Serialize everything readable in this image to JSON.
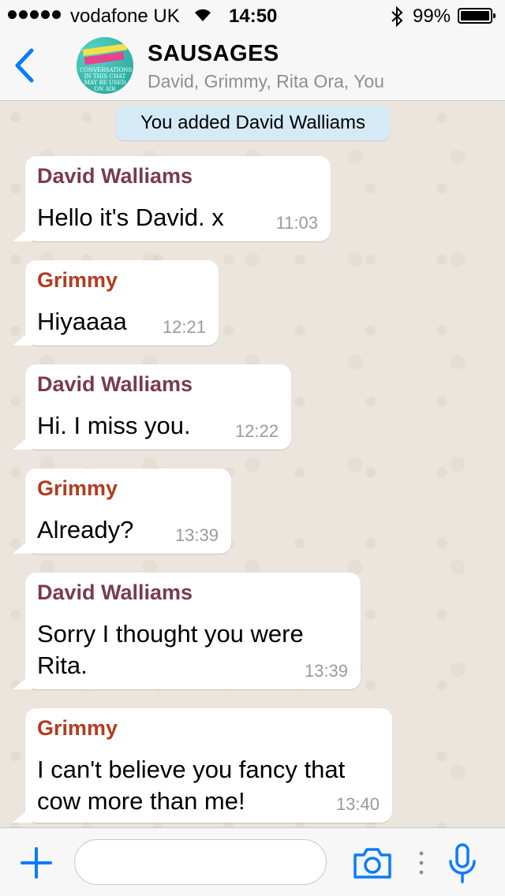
{
  "status_bar": {
    "carrier": "vodafone UK",
    "time": "14:50",
    "battery": "99%"
  },
  "header": {
    "title": "SAUSAGES",
    "subtitle": "David, Grimmy, Rita Ora, You",
    "avatar_caption": "CONVERSATIONS IN THIS CHAT MAY BE USED ON AIR"
  },
  "chat": {
    "system_message": "You added David Walliams",
    "messages": [
      {
        "sender": "David Walliams",
        "text": "Hello it's David. x",
        "time": "11:03"
      },
      {
        "sender": "Grimmy",
        "text": "Hiyaaaa",
        "time": "12:21"
      },
      {
        "sender": "David Walliams",
        "text": "Hi. I miss you.",
        "time": "12:22"
      },
      {
        "sender": "Grimmy",
        "text": "Already?",
        "time": "13:39"
      },
      {
        "sender": "David Walliams",
        "text_lines": [
          "Sorry I thought you were",
          "Rita."
        ],
        "time": "13:39"
      },
      {
        "sender": "Grimmy",
        "text_lines": [
          "I can't believe you fancy that",
          "cow more than me!"
        ],
        "time": "13:40"
      }
    ]
  },
  "input_bar": {
    "placeholder": ""
  },
  "colors": {
    "accent": "#0a7cff",
    "david_name": "#7a3b4e",
    "grimmy_name": "#b43b1e",
    "system_bubble": "#d5eaf7",
    "chat_background": "#ece5dd"
  },
  "icons": [
    "back-chevron-icon",
    "plus-icon",
    "camera-icon",
    "more-dots-icon",
    "microphone-icon",
    "wifi-icon",
    "bluetooth-icon",
    "battery-icon"
  ]
}
